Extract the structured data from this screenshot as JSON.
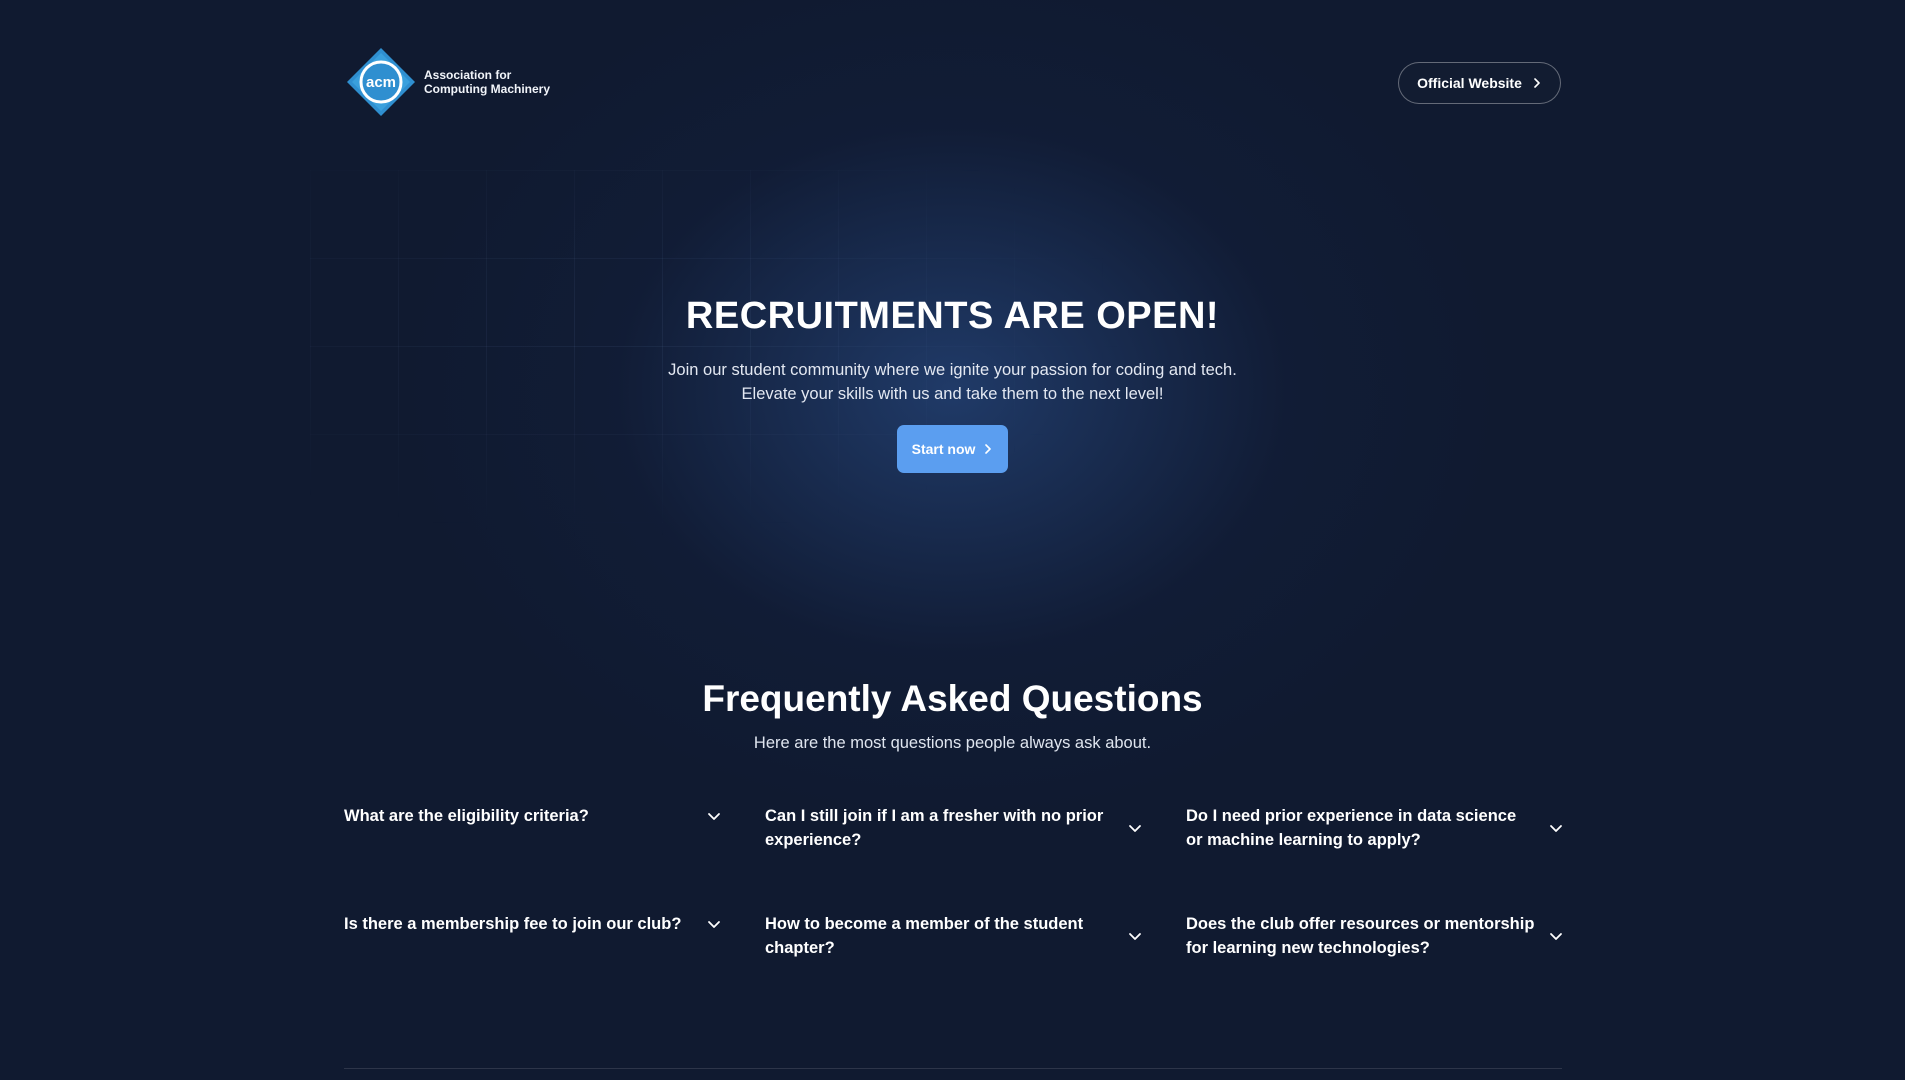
{
  "header": {
    "logo": {
      "mark_text": "acm",
      "line1": "Association for",
      "line2": "Computing Machinery"
    },
    "official_button": {
      "label": "Official Website",
      "icon": "chevron-right-icon"
    }
  },
  "hero": {
    "title": "RECRUITMENTS ARE OPEN!",
    "subtitle_line1": "Join our student community where we ignite your passion for coding and tech.",
    "subtitle_line2": "Elevate your skills with us and take them to the next level!",
    "cta": {
      "label": "Start now",
      "icon": "chevron-right-icon"
    }
  },
  "faq": {
    "title": "Frequently Asked Questions",
    "subtitle": "Here are the most questions people always ask about.",
    "items": [
      {
        "question": "What are the eligibility criteria?",
        "icon": "chevron-down-icon"
      },
      {
        "question": "Can I still join if I am a fresher with no prior experience?",
        "icon": "chevron-down-icon"
      },
      {
        "question": "Do I need prior experience in data science or machine learning to apply?",
        "icon": "chevron-down-icon"
      },
      {
        "question": "Is there a membership fee to join our club?",
        "icon": "chevron-down-icon"
      },
      {
        "question": "How to become a member of the student chapter?",
        "icon": "chevron-down-icon"
      },
      {
        "question": "Does the club offer resources or mentorship for learning new technologies?",
        "icon": "chevron-down-icon"
      }
    ]
  },
  "colors": {
    "background": "#101a30",
    "accent": "#5b9ef0",
    "logo_blue": "#2f8fd0"
  }
}
